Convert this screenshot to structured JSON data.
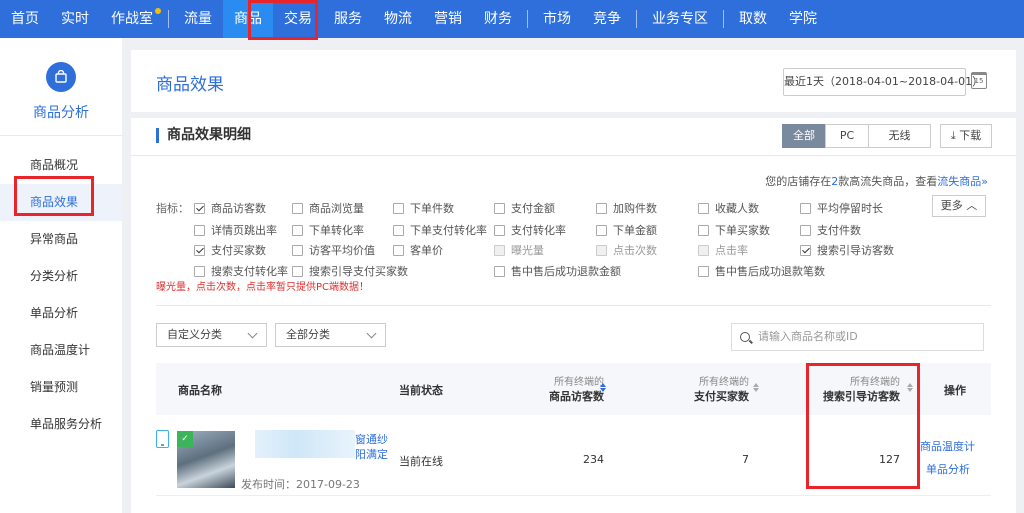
{
  "nav": {
    "items": [
      "首页",
      "实时",
      "作战室",
      "流量",
      "商品",
      "交易",
      "服务",
      "物流",
      "营销",
      "财务",
      "市场",
      "竞争",
      "业务专区",
      "取数",
      "学院"
    ],
    "active_index": 4,
    "accent_color": "#2e6fdc",
    "highlight_color": "#e7252a"
  },
  "sidebar": {
    "title": "商品分析",
    "icon": "shopping-bag-icon",
    "items": [
      "商品概况",
      "商品效果",
      "异常商品",
      "分类分析",
      "单品分析",
      "商品温度计",
      "销量预测",
      "单品服务分析"
    ],
    "active_index": 1
  },
  "header": {
    "title": "商品效果",
    "date_range": "最近1天（2018-04-01~2018-04-01）",
    "calendar_day": "15"
  },
  "section": {
    "title": "商品效果明细",
    "segments": [
      "全部",
      "PC",
      "无线"
    ],
    "active_segment": 0,
    "download_label": "下载"
  },
  "notice": {
    "prefix": "您的店铺存在",
    "count": "2",
    "middle": "款高流失商品，查看",
    "link": "流失商品»"
  },
  "metrics": {
    "label": "指标：",
    "more_label": "更多",
    "items": [
      {
        "label": "商品访客数",
        "checked": true,
        "disabled": false
      },
      {
        "label": "商品浏览量",
        "checked": false,
        "disabled": false
      },
      {
        "label": "下单件数",
        "checked": false,
        "disabled": false
      },
      {
        "label": "支付金额",
        "checked": false,
        "disabled": false
      },
      {
        "label": "加购件数",
        "checked": false,
        "disabled": false
      },
      {
        "label": "收藏人数",
        "checked": false,
        "disabled": false
      },
      {
        "label": "平均停留时长",
        "checked": false,
        "disabled": false
      },
      {
        "label": "详情页跳出率",
        "checked": false,
        "disabled": false
      },
      {
        "label": "下单转化率",
        "checked": false,
        "disabled": false
      },
      {
        "label": "下单支付转化率",
        "checked": false,
        "disabled": false
      },
      {
        "label": "支付转化率",
        "checked": false,
        "disabled": false
      },
      {
        "label": "下单金额",
        "checked": false,
        "disabled": false
      },
      {
        "label": "下单买家数",
        "checked": false,
        "disabled": false
      },
      {
        "label": "支付件数",
        "checked": false,
        "disabled": false
      },
      {
        "label": "支付买家数",
        "checked": true,
        "disabled": false
      },
      {
        "label": "访客平均价值",
        "checked": false,
        "disabled": false
      },
      {
        "label": "客单价",
        "checked": false,
        "disabled": false
      },
      {
        "label": "曝光量",
        "checked": false,
        "disabled": true
      },
      {
        "label": "点击次数",
        "checked": false,
        "disabled": true
      },
      {
        "label": "点击率",
        "checked": false,
        "disabled": true
      },
      {
        "label": "搜索引导访客数",
        "checked": true,
        "disabled": false
      },
      {
        "label": "搜索支付转化率",
        "checked": false,
        "disabled": false
      },
      {
        "label": "搜索引导支付买家数",
        "checked": false,
        "disabled": false
      },
      {
        "label": "售中售后成功退款金额",
        "checked": false,
        "disabled": false
      },
      {
        "label": "售中售后成功退款笔数",
        "checked": false,
        "disabled": false
      }
    ],
    "warning": "曝光量，点击次数，点击率暂只提供PC端数据！"
  },
  "filters": {
    "custom_category": "自定义分类",
    "all_category": "全部分类",
    "search_placeholder": "请输入商品名称或ID"
  },
  "table": {
    "headers": {
      "name": "商品名称",
      "status": "当前状态",
      "col1_sub": "所有终端的",
      "col1": "商品访客数",
      "col2_sub": "所有终端的",
      "col2": "支付买家数",
      "col3_sub": "所有终端的",
      "col3": "搜索引导访客数",
      "action": "操作"
    },
    "rows": [
      {
        "title_tail_1": "窗通纱",
        "title_tail_2": "阳满定",
        "published": "发布时间：2017-09-23",
        "status": "当前在线",
        "visitors": "234",
        "buyers": "7",
        "search_visitors": "127",
        "actions": [
          "商品温度计",
          "单品分析"
        ]
      }
    ]
  }
}
